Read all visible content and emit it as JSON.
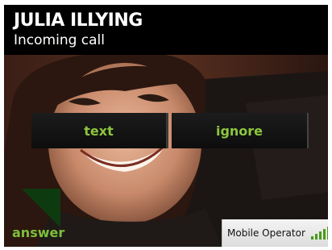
{
  "call": {
    "caller_name": "JULIA ILLYING",
    "status": "Incoming call"
  },
  "actions": {
    "text_label": "text",
    "ignore_label": "ignore",
    "answer_label": "answer"
  },
  "status_bar": {
    "operator": "Mobile Operator",
    "signal_icon": "signal-bars-icon",
    "signal_level": 1.0
  },
  "colors": {
    "accent_green": "#8cc63f",
    "answer_tab": "#0e3a10",
    "background": "#000000"
  }
}
